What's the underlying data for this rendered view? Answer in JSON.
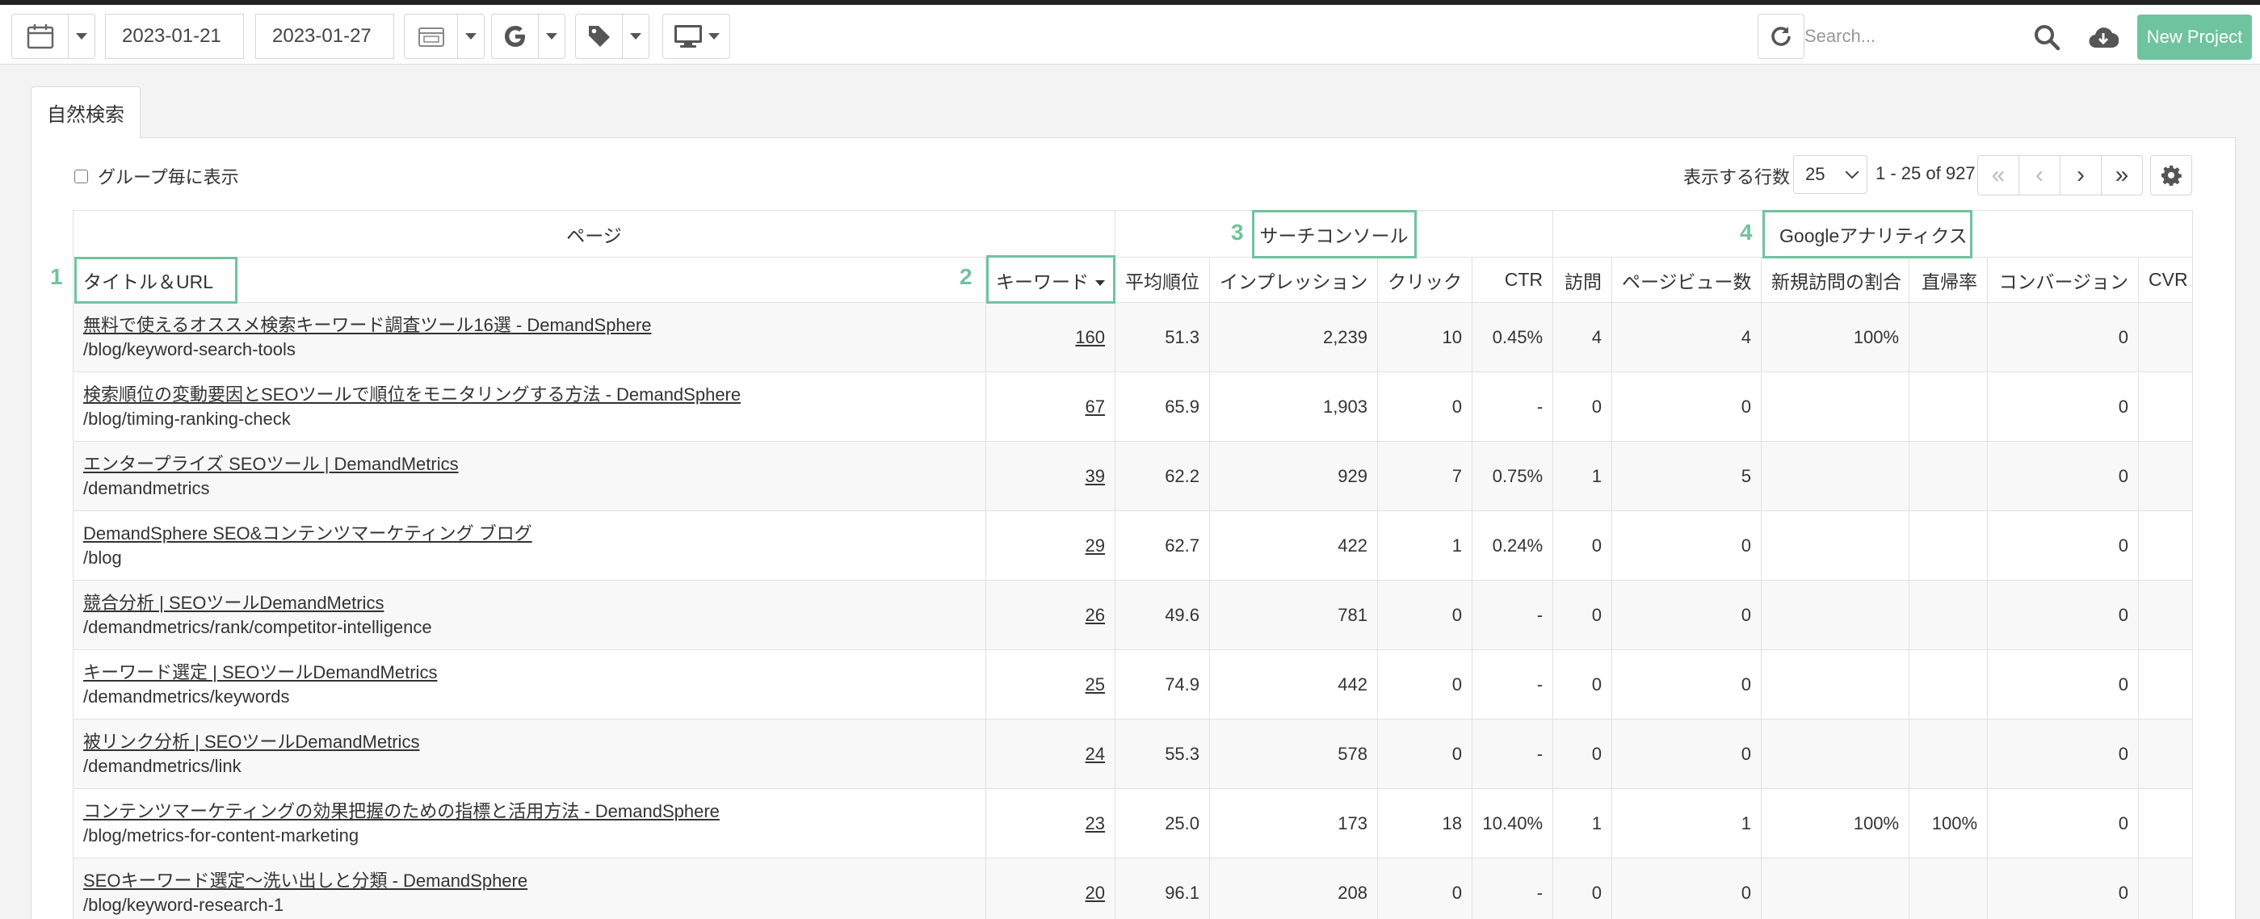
{
  "toolbar": {
    "start_date": "2023-01-21",
    "end_date": "2023-01-27",
    "search_placeholder": "Search...",
    "new_project_label": "New Project",
    "icons": [
      "calendar-icon",
      "calendar-range-icon",
      "google-icon",
      "tag-icon",
      "desktop-icon",
      "refresh-icon",
      "search-icon",
      "cloud-download-icon"
    ]
  },
  "tab": {
    "label": "自然検索"
  },
  "controls": {
    "group_checkbox_label": "グループ毎に表示",
    "rows_label": "表示する行数",
    "rows_value": "25",
    "range_text": "1 - 25 of 927"
  },
  "table": {
    "groups": {
      "page": "ページ",
      "search_console": "サーチコンソール",
      "analytics": "Googleアナリティクス"
    },
    "columns": {
      "title_url": "タイトル＆URL",
      "keywords": "キーワード",
      "avg_rank": "平均順位",
      "impressions": "インプレッション",
      "clicks": "クリック",
      "ctr": "CTR",
      "visits": "訪問",
      "pageviews": "ページビュー数",
      "new_visit_rate": "新規訪問の割合",
      "bounce_rate": "直帰率",
      "conversions": "コンバージョン",
      "cvr": "CVR"
    },
    "rows": [
      {
        "title": "無料で使えるオススメ検索キーワード調査ツール16選 - DemandSphere",
        "url": "/blog/keyword-search-tools",
        "keywords": "160",
        "avg_rank": "51.3",
        "impressions": "2,239",
        "clicks": "10",
        "ctr": "0.45%",
        "visits": "4",
        "pageviews": "4",
        "new_visit_rate": "100%",
        "bounce_rate": "",
        "conversions": "0",
        "cvr": ""
      },
      {
        "title": "検索順位の変動要因とSEOツールで順位をモニタリングする方法 - DemandSphere",
        "url": "/blog/timing-ranking-check",
        "keywords": "67",
        "avg_rank": "65.9",
        "impressions": "1,903",
        "clicks": "0",
        "ctr": "-",
        "visits": "0",
        "pageviews": "0",
        "new_visit_rate": "",
        "bounce_rate": "",
        "conversions": "0",
        "cvr": ""
      },
      {
        "title": "エンタープライズ SEOツール | DemandMetrics",
        "url": "/demandmetrics",
        "keywords": "39",
        "avg_rank": "62.2",
        "impressions": "929",
        "clicks": "7",
        "ctr": "0.75%",
        "visits": "1",
        "pageviews": "5",
        "new_visit_rate": "",
        "bounce_rate": "",
        "conversions": "0",
        "cvr": ""
      },
      {
        "title": "DemandSphere SEO&コンテンツマーケティング ブログ",
        "url": "/blog",
        "keywords": "29",
        "avg_rank": "62.7",
        "impressions": "422",
        "clicks": "1",
        "ctr": "0.24%",
        "visits": "0",
        "pageviews": "0",
        "new_visit_rate": "",
        "bounce_rate": "",
        "conversions": "0",
        "cvr": ""
      },
      {
        "title": "競合分析 | SEOツールDemandMetrics",
        "url": "/demandmetrics/rank/competitor-intelligence",
        "keywords": "26",
        "avg_rank": "49.6",
        "impressions": "781",
        "clicks": "0",
        "ctr": "-",
        "visits": "0",
        "pageviews": "0",
        "new_visit_rate": "",
        "bounce_rate": "",
        "conversions": "0",
        "cvr": ""
      },
      {
        "title": "キーワード選定 | SEOツールDemandMetrics",
        "url": "/demandmetrics/keywords",
        "keywords": "25",
        "avg_rank": "74.9",
        "impressions": "442",
        "clicks": "0",
        "ctr": "-",
        "visits": "0",
        "pageviews": "0",
        "new_visit_rate": "",
        "bounce_rate": "",
        "conversions": "0",
        "cvr": ""
      },
      {
        "title": "被リンク分析 | SEOツールDemandMetrics",
        "url": "/demandmetrics/link",
        "keywords": "24",
        "avg_rank": "55.3",
        "impressions": "578",
        "clicks": "0",
        "ctr": "-",
        "visits": "0",
        "pageviews": "0",
        "new_visit_rate": "",
        "bounce_rate": "",
        "conversions": "0",
        "cvr": ""
      },
      {
        "title": "コンテンツマーケティングの効果把握のための指標と活用方法 - DemandSphere",
        "url": "/blog/metrics-for-content-marketing",
        "keywords": "23",
        "avg_rank": "25.0",
        "impressions": "173",
        "clicks": "18",
        "ctr": "10.40%",
        "visits": "1",
        "pageviews": "1",
        "new_visit_rate": "100%",
        "bounce_rate": "100%",
        "conversions": "0",
        "cvr": ""
      },
      {
        "title": "SEOキーワード選定〜洗い出しと分類 - DemandSphere",
        "url": "/blog/keyword-research-1",
        "keywords": "20",
        "avg_rank": "96.1",
        "impressions": "208",
        "clicks": "0",
        "ctr": "-",
        "visits": "0",
        "pageviews": "0",
        "new_visit_rate": "",
        "bounce_rate": "",
        "conversions": "0",
        "cvr": ""
      }
    ]
  },
  "annotations": [
    "1",
    "2",
    "3",
    "4"
  ]
}
